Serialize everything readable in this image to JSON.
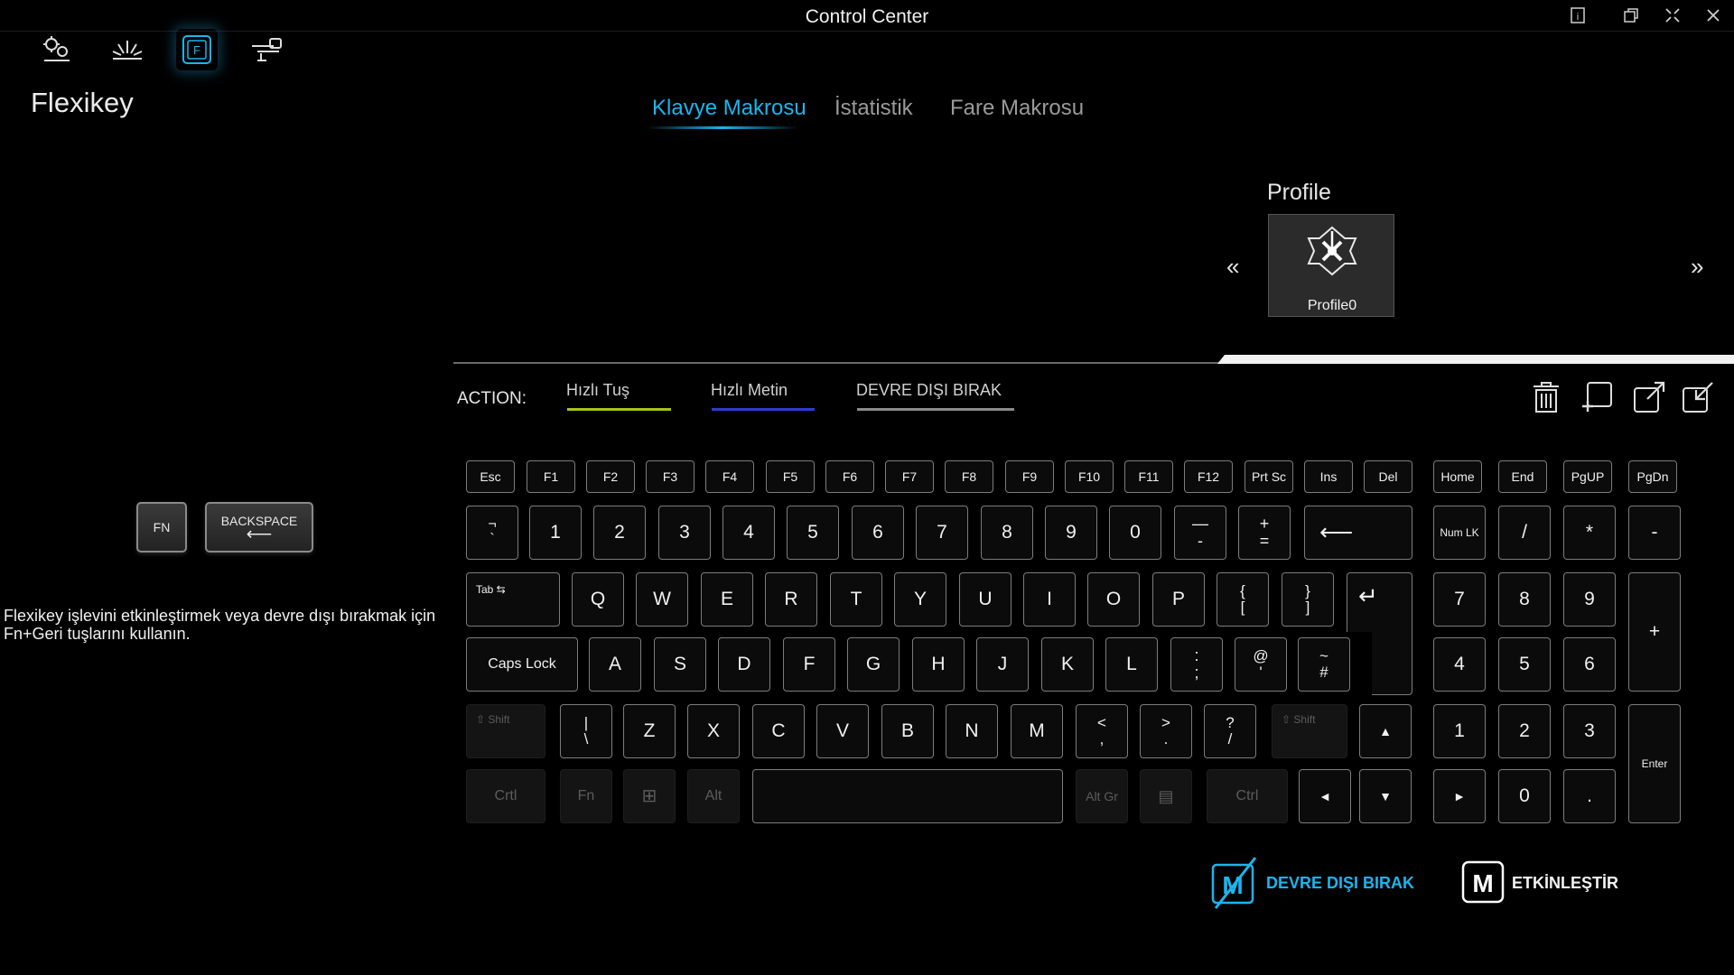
{
  "window": {
    "title": "Control Center"
  },
  "module": {
    "title": "Flexikey",
    "icons": [
      "settings-gear-icon",
      "light-rays-icon",
      "flexikey-icon",
      "network-speed-icon"
    ]
  },
  "tabs": [
    {
      "label": "Klavye Makrosu",
      "active": true
    },
    {
      "label": "İstatistik",
      "active": false
    },
    {
      "label": "Fare Makrosu",
      "active": false
    }
  ],
  "profile": {
    "label": "Profile",
    "name": "Profile0",
    "prev": "«",
    "next": "»"
  },
  "action": {
    "label": "ACTION:",
    "tabs": [
      {
        "label": "Hızlı Tuş",
        "color": "#a8c414"
      },
      {
        "label": "Hızlı Metin",
        "color": "#2f3bd6"
      },
      {
        "label": "DEVRE DIŞI BIRAK",
        "color": "#8a8a8a"
      }
    ]
  },
  "left": {
    "fn_key": "FN",
    "backspace_key": "BACKSPACE",
    "backspace_arrow": "⟵",
    "info": "Flexikey işlevini etkinleştirmek veya devre dışı bırakmak için Fn+Geri tuşlarını kullanın."
  },
  "keys": {
    "esc": "Esc",
    "f1": "F1",
    "f2": "F2",
    "f3": "F3",
    "f4": "F4",
    "f5": "F5",
    "f6": "F6",
    "f7": "F7",
    "f8": "F8",
    "f9": "F9",
    "f10": "F10",
    "f11": "F11",
    "f12": "F12",
    "prtsc": "Prt Sc",
    "ins": "Ins",
    "del": "Del",
    "home": "Home",
    "end": "End",
    "pgup": "PgUP",
    "pgdn": "PgDn",
    "grave_top": "¬",
    "grave_bottom": "`",
    "d1": "1",
    "d2": "2",
    "d3": "3",
    "d4": "4",
    "d5": "5",
    "d6": "6",
    "d7": "7",
    "d8": "8",
    "d9": "9",
    "d0": "0",
    "minus_top": "—",
    "minus_bottom": "-",
    "equal_top": "+",
    "equal_bottom": "=",
    "backspace": "⟵",
    "numlk": "Num LK",
    "np_slash": "/",
    "np_star": "*",
    "np_minus": "-",
    "tab": "Tab ⇆",
    "q": "Q",
    "w": "W",
    "e": "E",
    "r": "R",
    "t": "T",
    "y": "Y",
    "u": "U",
    "i": "I",
    "o": "O",
    "p": "P",
    "lbr_top": "{",
    "lbr_bottom": "[",
    "rbr_top": "}",
    "rbr_bottom": "]",
    "enter": "↵",
    "np7": "7",
    "np8": "8",
    "np9": "9",
    "np_plus": "+",
    "caps": "Caps Lock",
    "a": "A",
    "s": "S",
    "d": "D",
    "f": "F",
    "g": "G",
    "h": "H",
    "j": "J",
    "k": "K",
    "l": "L",
    "semi_top": ":",
    "semi_bottom": ";",
    "quote_top": "@",
    "quote_bottom": "'",
    "hash_top": "~",
    "hash_bottom": "#",
    "np4": "4",
    "np5": "5",
    "np6": "6",
    "lshift": "⇧ Shift",
    "bslash_top": "|",
    "bslash_bottom": "\\",
    "z": "Z",
    "x": "X",
    "c": "C",
    "v": "V",
    "b": "B",
    "n": "N",
    "m": "M",
    "comma_top": "<",
    "comma_bottom": ",",
    "period_top": ">",
    "period_bottom": ".",
    "slash_top": "?",
    "slash_bottom": "/",
    "rshift": "⇧ Shift",
    "up": "▲",
    "np1": "1",
    "np2": "2",
    "np3": "3",
    "np_enter": "Enter",
    "lctrl": "Crtl",
    "fn": "Fn",
    "win": "⊞",
    "alt": "Alt",
    "altgr": "Alt Gr",
    "menu": "▤",
    "rctrl": "Ctrl",
    "left": "◄",
    "down": "▼",
    "right": "►",
    "np0": "0",
    "np_dot": "."
  },
  "bottom": {
    "disable_label": "DEVRE DIŞI BIRAK",
    "disable_color": "#19b6f0",
    "enable_label": "ETKİNLEŞTİR",
    "enable_icon_letter": "M"
  }
}
